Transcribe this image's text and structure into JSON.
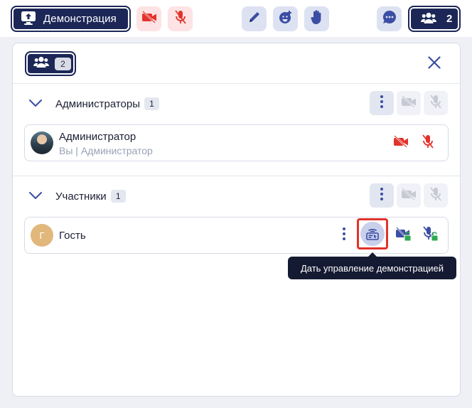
{
  "toolbar": {
    "demo_label": "Демонстрация",
    "participants_count": "2"
  },
  "panel": {
    "tab_count": "2",
    "groups": [
      {
        "title": "Администраторы",
        "count": "1",
        "participants": [
          {
            "name": "Администратор",
            "subtitle": "Вы | Администратор"
          }
        ]
      },
      {
        "title": "Участники",
        "count": "1",
        "participants": [
          {
            "name": "Гость",
            "avatar_letter": "Г"
          }
        ]
      }
    ]
  },
  "tooltip": {
    "text": "Дать управление демонстрацией"
  },
  "colors": {
    "primary": "#1c2757",
    "danger": "#e3322b",
    "success": "#2fa84f",
    "accent": "#3b4ea3",
    "tooltip_bg": "#151a33"
  },
  "icons": [
    "screen-share-icon",
    "camera-off-icon",
    "mic-off-icon",
    "pencil-icon",
    "emoji-plus-icon",
    "raise-hand-icon",
    "chat-icon",
    "users-icon",
    "close-icon",
    "chevron-down-icon",
    "more-vertical-icon",
    "give-control-icon",
    "camera-permission-icon",
    "mic-permission-icon"
  ]
}
